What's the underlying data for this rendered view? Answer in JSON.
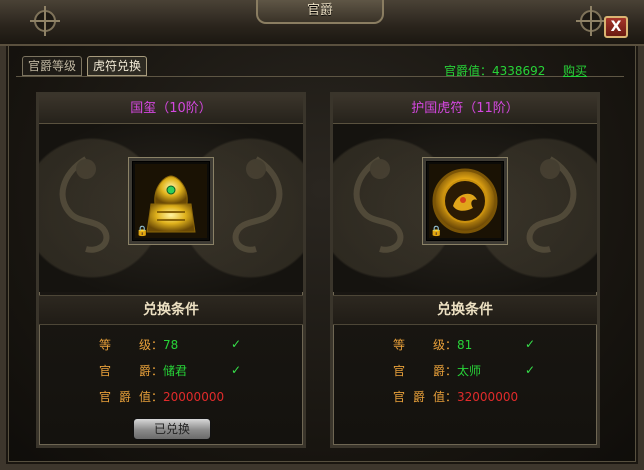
{
  "window": {
    "title": "官爵",
    "close_label": "X"
  },
  "tabs": [
    {
      "label": "官爵等级",
      "active": false
    },
    {
      "label": "虎符兑换",
      "active": true
    }
  ],
  "header": {
    "rank_value_label": "官爵值：4338692",
    "buy_label": "购买"
  },
  "panels": [
    {
      "title": "国玺（10阶）",
      "item_icon": "golden-seal-icon",
      "conditions_title": "兑换条件",
      "level": {
        "label": "等级",
        "value": "78",
        "met": true
      },
      "rank": {
        "label": "官爵",
        "value": "储君",
        "met": true
      },
      "rank_points": {
        "label": "官爵值",
        "value": "20000000"
      },
      "button_label": "已兑换"
    },
    {
      "title": "护国虎符（11阶）",
      "item_icon": "tiger-talisman-icon",
      "conditions_title": "兑换条件",
      "level": {
        "label": "等级",
        "value": "81",
        "met": true
      },
      "rank": {
        "label": "官爵",
        "value": "太师",
        "met": true
      },
      "rank_points": {
        "label": "官爵值",
        "value": "32000000"
      }
    }
  ],
  "check_mark": "✓",
  "colors": {
    "title_magenta": "#d447e0",
    "value_green": "#27d438",
    "label_orange": "#e8a03a",
    "points_red": "#e12b2b"
  }
}
